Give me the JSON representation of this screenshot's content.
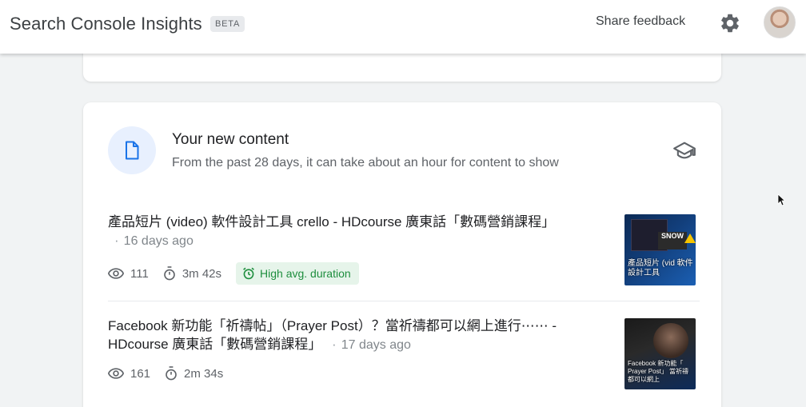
{
  "header": {
    "title": "Search Console Insights",
    "badge": "BETA",
    "share_feedback": "Share feedback",
    "settings_icon": "gear-icon",
    "avatar_icon": "account-avatar"
  },
  "card": {
    "icon": "document-icon",
    "title": "Your new content",
    "subtitle": "From the past 28 days, it can take about an hour for content to show",
    "learn_icon": "school-icon",
    "items": [
      {
        "title": "產品短片 (video) 軟件設計工具 crello - HDcourse 廣東話「數碼營銷課程」",
        "separator": "·",
        "date": "16 days ago",
        "views": "111",
        "duration": "3m 42s",
        "badge": "High avg. duration",
        "thumbnail_text": "產品短片 (vid 軟件設計工具",
        "thumbnail_overlay": "SNOW"
      },
      {
        "title": "Facebook 新功能「祈禱帖」（Prayer Post）？當祈禱都可以網上進行⋯⋯ - HDcourse 廣東話「數碼營銷課程」",
        "separator": "·",
        "date": "17 days ago",
        "views": "161",
        "duration": "2m 34s",
        "thumbnail_text": "Facebook 新功能「 Prayer Post」 當祈禱都可以網上"
      }
    ]
  },
  "colors": {
    "accent_blue": "#1a73e8",
    "success_green": "#1e8e3e",
    "success_bg": "#e6f4ea"
  }
}
